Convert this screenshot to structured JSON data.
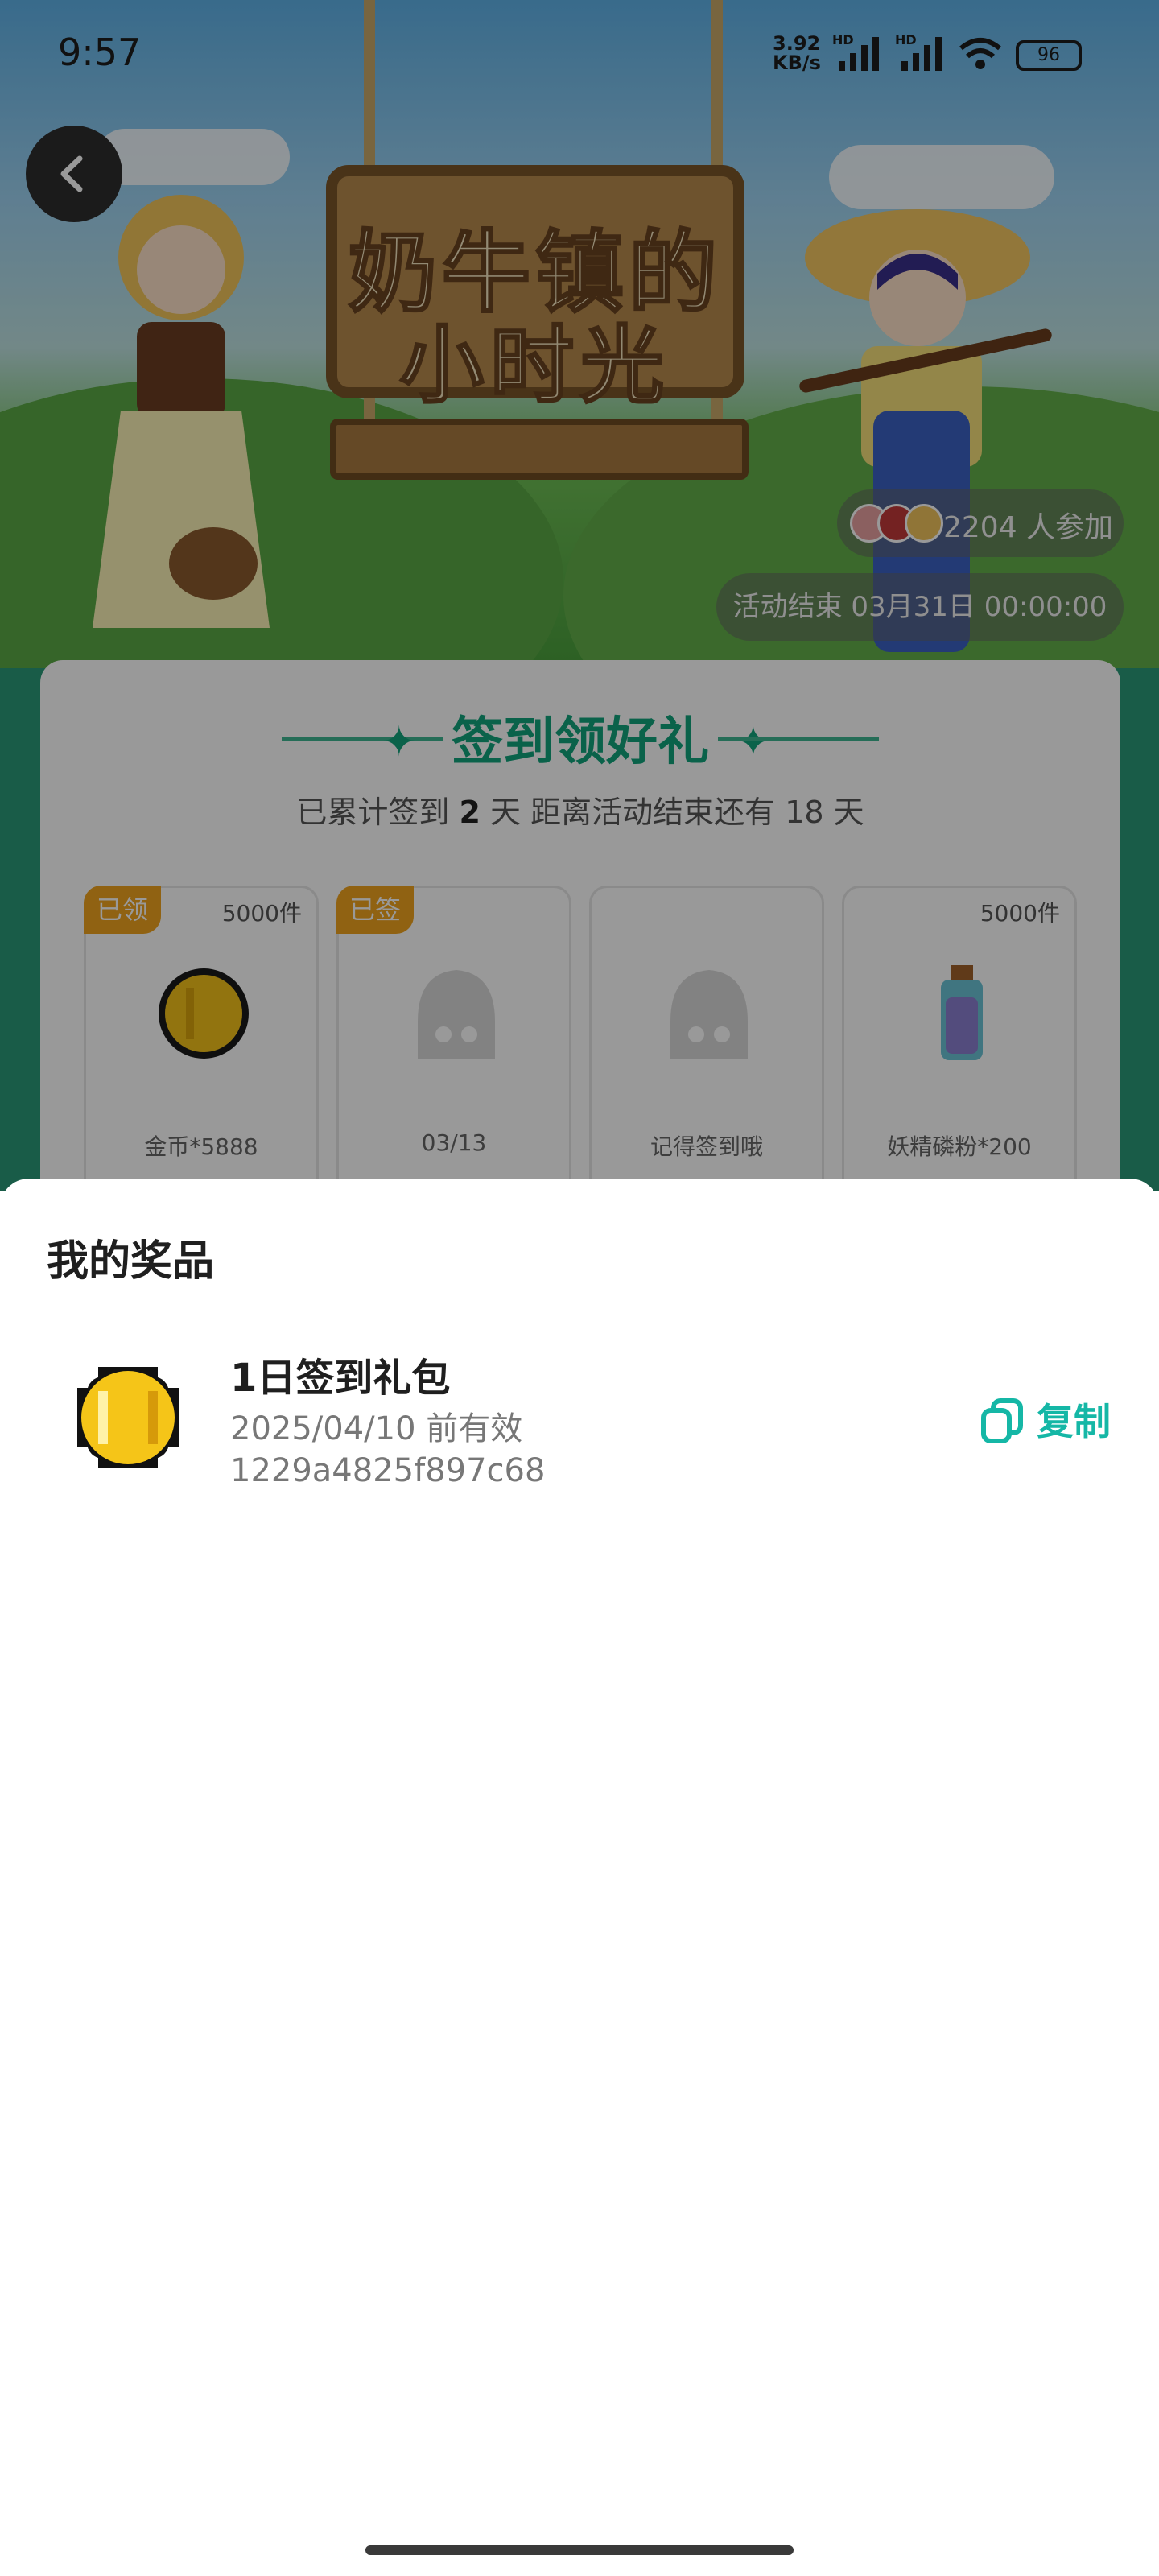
{
  "status_bar": {
    "time": "9:57",
    "net_speed_value": "3.92",
    "net_speed_unit": "KB/s",
    "hd_1": "HD",
    "hd_2": "HD",
    "battery": "96"
  },
  "app_header": {
    "back_icon": "chevron-left-icon"
  },
  "hero": {
    "game_title_line1": "奶牛镇的",
    "game_title_line2": "小时光",
    "participants": "2204 人参加",
    "end_time": "活动结束 03月31日 00:00:00"
  },
  "checkin": {
    "title": "签到领好礼",
    "summary_prefix": "已累计签到",
    "summary_days": "2",
    "summary_suffix": "天  距离活动结束还有 18 天",
    "rewards": [
      {
        "badge": "已领",
        "stock": "5000件",
        "label": "金币*5888",
        "icon": "gold-coin-icon"
      },
      {
        "badge": "已签",
        "stock": "",
        "label": "03/13",
        "icon": "mascot-placeholder-icon"
      },
      {
        "badge": "",
        "stock": "",
        "label": "记得签到哦",
        "icon": "mascot-placeholder-icon"
      },
      {
        "badge": "",
        "stock": "5000件",
        "label": "妖精磷粉*200",
        "icon": "potion-bottle-icon"
      }
    ]
  },
  "sheet": {
    "title": "我的奖品",
    "prize": {
      "name": "1日签到礼包",
      "expiry": "2025/04/10 前有效",
      "code": "1229a4825f897c68",
      "icon": "gold-coin-icon"
    },
    "copy_label": "复制",
    "copy_icon": "copy-icon"
  },
  "colors": {
    "accent": "#15b7a6",
    "checkin_green": "#12a37c",
    "badge_orange": "#f0a41e"
  }
}
